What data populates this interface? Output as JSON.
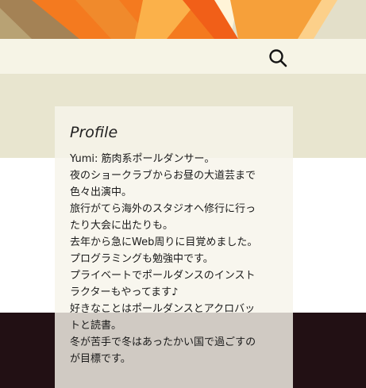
{
  "header": {
    "search_icon": "search-icon",
    "colors": {
      "banner_bg": "#e3dfc9",
      "orange": "#f47a1f",
      "light_orange": "#f6a03a",
      "brown": "#a48255",
      "navbar_bg": "#f6f4e6",
      "content_bg": "#e8e5cf",
      "footer_bg": "#221014"
    }
  },
  "widget": {
    "title": "Profile",
    "lines": [
      "Yumi: 筋肉系ポールダンサー。",
      "夜のショークラブからお昼の大道芸まで",
      "色々出演中。",
      "旅行がてら海外のスタジオへ修行に行っ",
      "たり大会に出たりも。",
      "去年から急にWeb周りに目覚めました。",
      "プログラミングも勉強中です。",
      "プライベートでポールダンスのインスト",
      "ラクターもやってます♪",
      "好きなことはポールダンスとアクロバッ",
      "トと読書。",
      "冬が苦手で冬はあったかい国で過ごすの",
      "が目標です。"
    ]
  }
}
